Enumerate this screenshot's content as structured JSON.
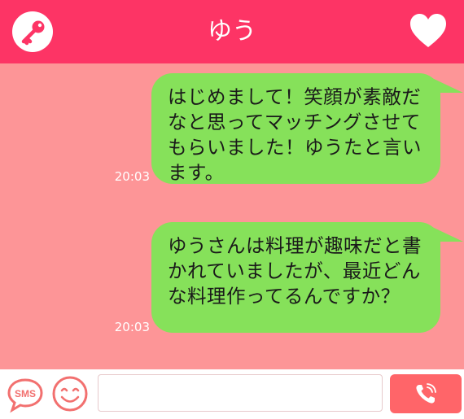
{
  "header": {
    "title": "ゆう",
    "left_icon": "key-icon",
    "right_icon": "heart-icon"
  },
  "messages": [
    {
      "text": "はじめまして！笑顔が素敵だなと思ってマッチングさせてもらいました！ゆうたと言います。",
      "time": "20:03"
    },
    {
      "text": "ゆうさんは料理が趣味だと書かれていましたが、最近どんな料理作ってるんですか？",
      "time": "20:03"
    }
  ],
  "footer": {
    "sms_label": "SMS",
    "emoji_icon": "smiley-icon",
    "input_value": "",
    "call_icon": "phone-icon"
  },
  "colors": {
    "header": "#fd3465",
    "background": "#fd9597",
    "bubble": "#86e15a",
    "call_button": "#ff6569",
    "sms_accent": "#f2706f"
  }
}
